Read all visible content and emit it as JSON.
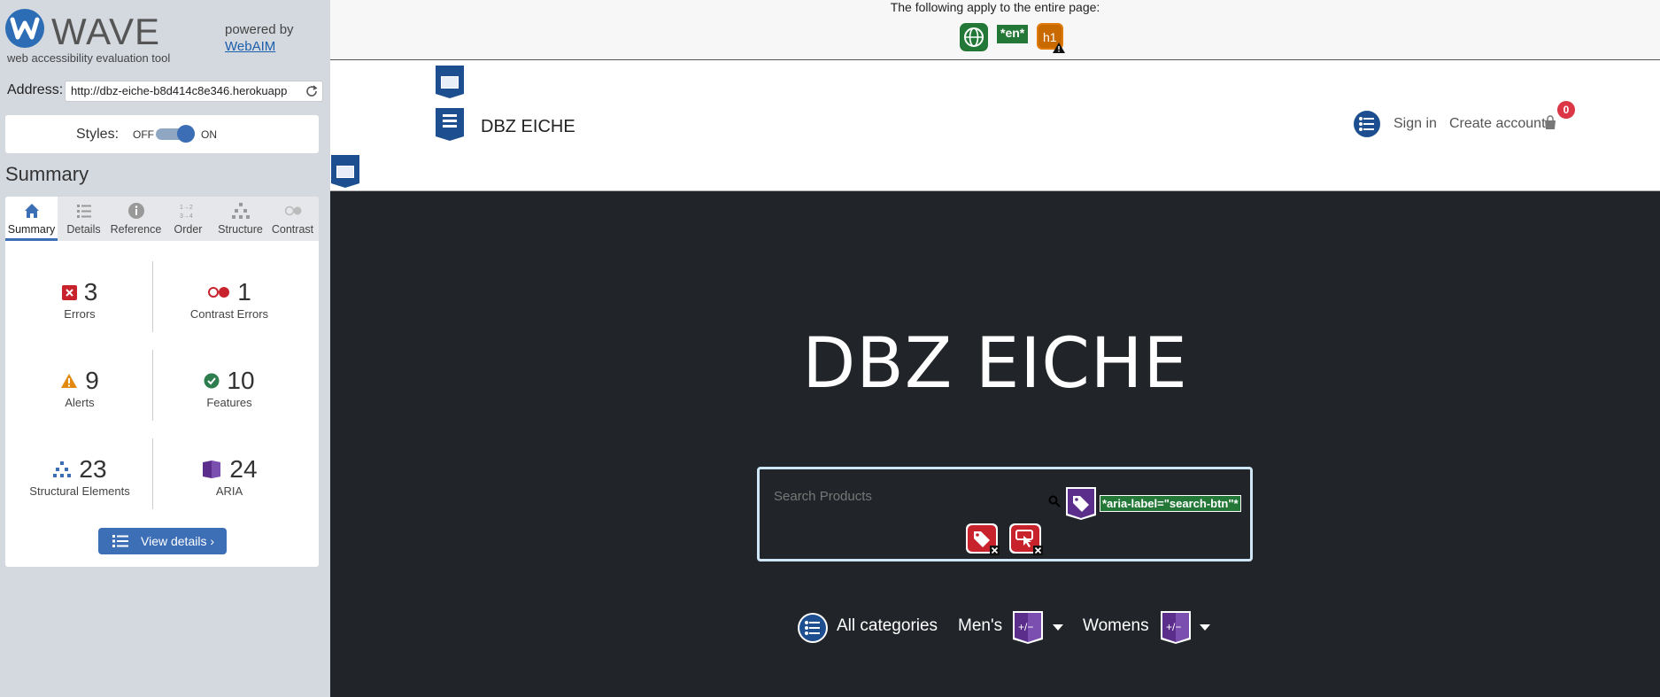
{
  "wave": {
    "name": "WAVE",
    "tagline": "web accessibility evaluation tool",
    "powered_by": "powered by",
    "webaim_link": "WebAIM",
    "address_label": "Address:",
    "address_value": "http://dbz-eiche-b8d414c8e346.herokuapp",
    "styles_label": "Styles:",
    "styles_off": "OFF",
    "styles_on": "ON",
    "summary_title": "Summary",
    "tabs": [
      {
        "label": "Summary",
        "icon": "home-icon"
      },
      {
        "label": "Details",
        "icon": "list-icon"
      },
      {
        "label": "Reference",
        "icon": "info-icon"
      },
      {
        "label": "Order",
        "icon": "order-icon"
      },
      {
        "label": "Structure",
        "icon": "structure-icon"
      },
      {
        "label": "Contrast",
        "icon": "contrast-icon"
      }
    ],
    "active_tab": "Summary",
    "stats": {
      "errors": {
        "value": "3",
        "label": "Errors",
        "color": "#c8232c"
      },
      "contrast_errors": {
        "value": "1",
        "label": "Contrast Errors",
        "color": "#c8232c"
      },
      "alerts": {
        "value": "9",
        "label": "Alerts",
        "color": "#e28a0f"
      },
      "features": {
        "value": "10",
        "label": "Features",
        "color": "#2e7d4f"
      },
      "structural": {
        "value": "23",
        "label": "Structural Elements",
        "color": "#3b6eb4"
      },
      "aria": {
        "value": "24",
        "label": "ARIA",
        "color": "#5b2e8c"
      }
    },
    "view_details": "View details ›"
  },
  "page": {
    "topbar_text": "The following apply to the entire page:",
    "lang_badge": "*en*",
    "brand": "DBZ EICHE",
    "nav": {
      "sign_in": "Sign in",
      "create_account": "Create account",
      "cart_count": "0"
    },
    "hero": {
      "title": "DBZ EICHE",
      "search_placeholder": "Search Products",
      "aria_label_badge": "*aria-label=\"search-btn\"*",
      "categories": {
        "all": "All categories",
        "mens": "Men's",
        "womens": "Womens"
      }
    },
    "colors": {
      "hero_bg": "#212529",
      "error_red": "#c8232c",
      "aria_purple": "#5b2e8c",
      "structure_blue": "#1d4e8f",
      "feature_green": "#247837"
    }
  }
}
